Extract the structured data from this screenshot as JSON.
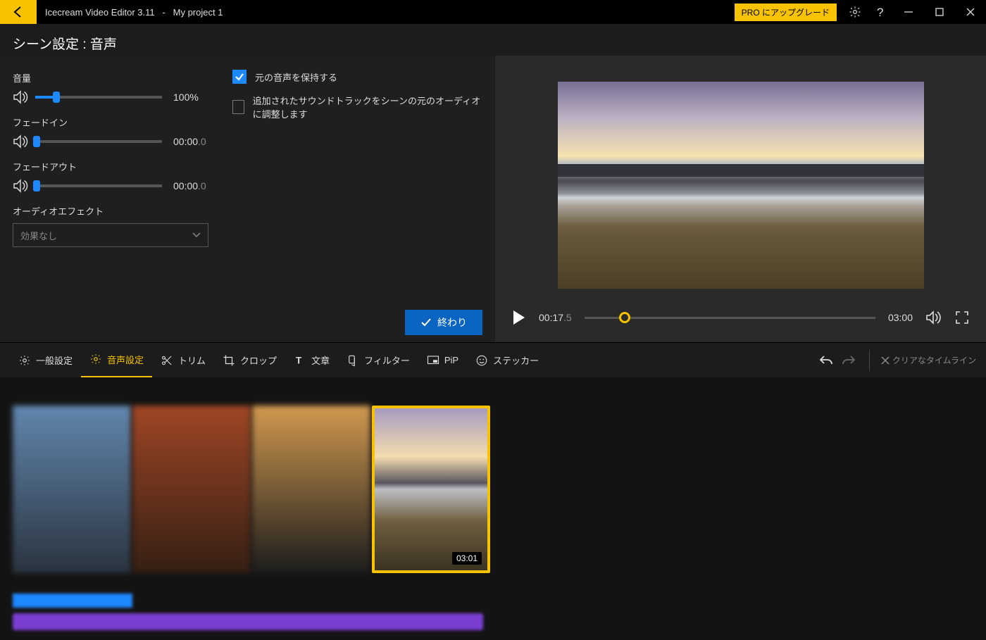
{
  "titlebar": {
    "app_name": "Icecream Video Editor 3.11",
    "separator": "-",
    "project_name": "My project 1",
    "pro_upgrade": "PRO にアップグレード"
  },
  "section_title": "シーン設定 : 音声",
  "controls": {
    "volume_label": "音量",
    "volume_value": "100%",
    "fadein_label": "フェードイン",
    "fadein_value": "00:00",
    "fadein_sub": ".0",
    "fadeout_label": "フェードアウト",
    "fadeout_value": "00:00",
    "fadeout_sub": ".0",
    "effect_label": "オーディオエフェクト",
    "effect_value": "効果なし"
  },
  "checkboxes": {
    "keep_original": "元の音声を保持する",
    "adjust_soundtrack": "追加されたサウンドトラックをシーンの元のオーディオに調整します"
  },
  "done_button": "終わり",
  "player": {
    "current": "00:17",
    "current_sub": ".5",
    "total": "03:00"
  },
  "tabs": {
    "general": "一般設定",
    "audio": "音声設定",
    "trim": "トリム",
    "crop": "クロップ",
    "text": "文章",
    "filter": "フィルター",
    "pip": "PiP",
    "sticker": "ステッカー"
  },
  "clear_timeline": "クリアなタイムライン",
  "clip": {
    "duration": "03:01"
  }
}
